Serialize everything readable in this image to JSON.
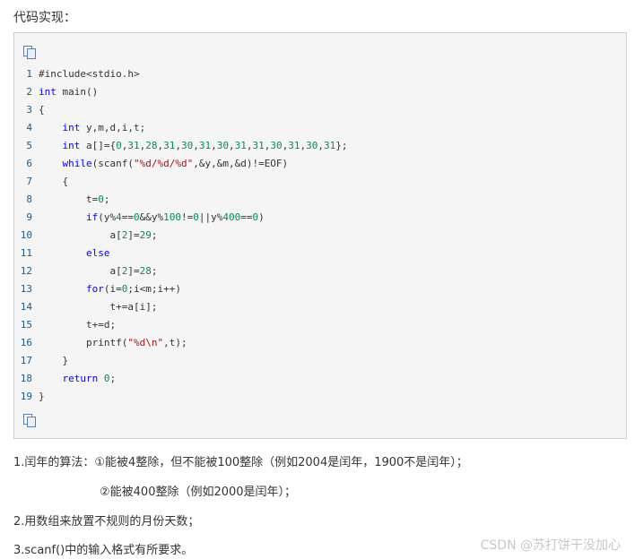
{
  "heading": "代码实现：",
  "code": {
    "line_numbers": [
      "1",
      "2",
      "3",
      "4",
      "5",
      "6",
      "7",
      "8",
      "9",
      "10",
      "11",
      "12",
      "13",
      "14",
      "15",
      "16",
      "17",
      "18",
      "19"
    ]
  },
  "notes": {
    "note1": "1.闰年的算法：①能被4整除，但不能被100整除（例如2004是闰年，1900不是闰年）；",
    "note1_cont": "②能被400整除（例如2000是闰年）；",
    "note2": "2.用数组来放置不规则的月份天数；",
    "note3": "3.scanf()中的输入格式有所要求。"
  },
  "watermark": "CSDN @苏打饼干没加心"
}
